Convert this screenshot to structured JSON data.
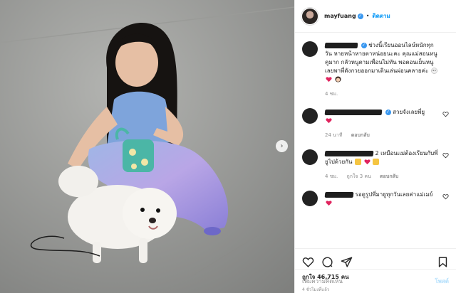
{
  "header": {
    "username": "mayfuang",
    "verified": true,
    "follow_label": "ติดตาม"
  },
  "caption": {
    "text": "ช่วงนี้เรียนออนไลน์หนักทุกวัน หายหน้าหายตาหน่อยนะคะ คุณแม่สอนหนูคูมาก กลัวหนูตามเพื่อนไม่ทัน พอตอนเย็นหนูเลยพาพี่ดังกวยออกมาเดินเล่นผ่อนคลายค่ะ",
    "time": "4 ชม."
  },
  "comments": [
    {
      "text": "สวยจังเลยพี่ยู",
      "time": "24 นาที",
      "reply": "ตอบกลับ",
      "likes": ""
    },
    {
      "text": "2 เหมือนแม่ต้องเรียนกับพี่ยูไปด้วยกัน",
      "time": "4 ชม.",
      "likes": "ถูกใจ 3 คน",
      "reply": "ตอบกลับ"
    },
    {
      "text": "รอดูรูปพี่มายูทุกวันเลยค่าแม่เมย์",
      "time": "",
      "reply": "",
      "likes": ""
    }
  ],
  "actions": {
    "likes_text": "ถูกใจ 46,715 คน",
    "posted_time": "4 ชั่วโมงที่แล้ว"
  },
  "add_comment": {
    "placeholder": "เพิ่มความคิดเห็น",
    "post_label": "โพสต์"
  },
  "icons": {
    "next": "chevron-right-icon",
    "like": "heart-outline-icon",
    "comment": "comment-bubble-icon",
    "share": "paper-plane-icon",
    "save": "bookmark-icon"
  },
  "colors": {
    "accent": "#0095f6",
    "verified": "#3897f0",
    "heart": "#ed4956",
    "muted": "#8e8e8e"
  }
}
